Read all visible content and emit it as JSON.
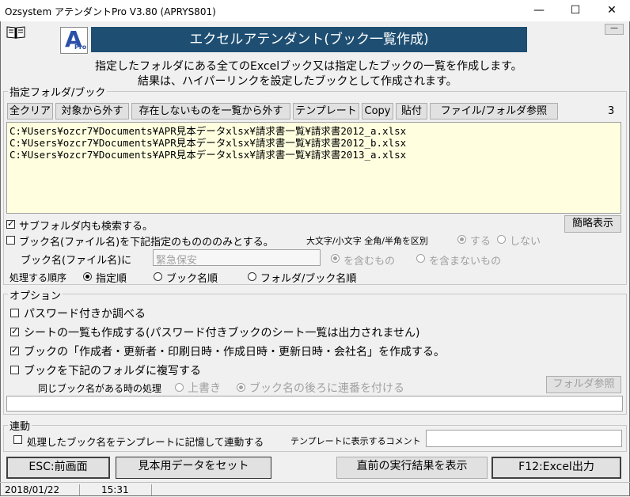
{
  "window": {
    "title": "Ozsystem アテンダントPro V3.80 (APRYS801)",
    "minimize": "—",
    "maximize": "☐",
    "close": "✕"
  },
  "header": {
    "logo_letter": "A",
    "logo_sub": "Pro",
    "banner": "エクセルアテンダント(ブック一覧作成)",
    "desc1": "指定したフォルダにある全てのExcelブック又は指定したブックの一覧を作成します。",
    "desc2": "結果は、ハイパーリンクを設定したブックとして作成されます。",
    "collapse_btn": "—"
  },
  "target": {
    "group_label": "指定フォルダ/ブック",
    "buttons": {
      "clear_all": "全クリア",
      "exclude": "対象から外す",
      "remove_missing": "存在しないものを一覧から外す",
      "template": "テンプレート",
      "copy": "Copy",
      "paste": "貼付",
      "browse": "ファイル/フォルダ参照"
    },
    "count": "3",
    "files": [
      "C:¥Users¥ozcr7¥Documents¥APR見本データxlsx¥請求書一覧¥請求書2012_a.xlsx",
      "C:¥Users¥ozcr7¥Documents¥APR見本データxlsx¥請求書一覧¥請求書2012_b.xlsx",
      "C:¥Users¥ozcr7¥Documents¥APR見本データxlsx¥請求書一覧¥請求書2013_a.xlsx"
    ],
    "search_subfolders": "サブフォルダ内も検索する。",
    "simple_view": "簡略表示",
    "name_filter_only": "ブック名(ファイル名)を下記指定のものののみとする。",
    "case_label": "大文字/小文字 全角/半角を区別",
    "case_yes": "する",
    "case_no": "しない",
    "name_label": "ブック名(ファイル名)に",
    "name_value": "緊急保安",
    "contains": "を含むもの",
    "not_contains": "を含まないもの",
    "order_label": "処理する順序",
    "order_specified": "指定順",
    "order_name": "ブック名順",
    "order_folder": "フォルダ/ブック名順"
  },
  "options": {
    "group_label": "オプション",
    "password": "パスワード付きか調べる",
    "sheet_list": "シートの一覧も作成する(パスワード付きブックのシート一覧は出力されません)",
    "properties": "ブックの「作成者・更新者・印刷日時・作成日時・更新日時・会社名」を作成する。",
    "copy_books": "ブックを下記のフォルダに複写する",
    "same_name_label": "同じブック名がある時の処理",
    "overwrite": "上書き",
    "append_number": "ブック名の後ろに連番を付ける",
    "folder_browse": "フォルダ参照",
    "folder_path": ""
  },
  "link": {
    "group_label": "連動",
    "remember": "処理したブック名をテンプレートに記憶して連動する",
    "comment_label": "テンプレートに表示するコメント",
    "comment_value": ""
  },
  "footer": {
    "esc": "ESC:前画面",
    "sample": "見本用データをセット",
    "last_result": "直前の実行結果を表示",
    "f12": "F12:Excel出力"
  },
  "status": {
    "date": "2018/01/22",
    "time": "15:31"
  },
  "colors": {
    "banner_bg": "#1e4f73",
    "list_bg": "#ffffe0"
  }
}
